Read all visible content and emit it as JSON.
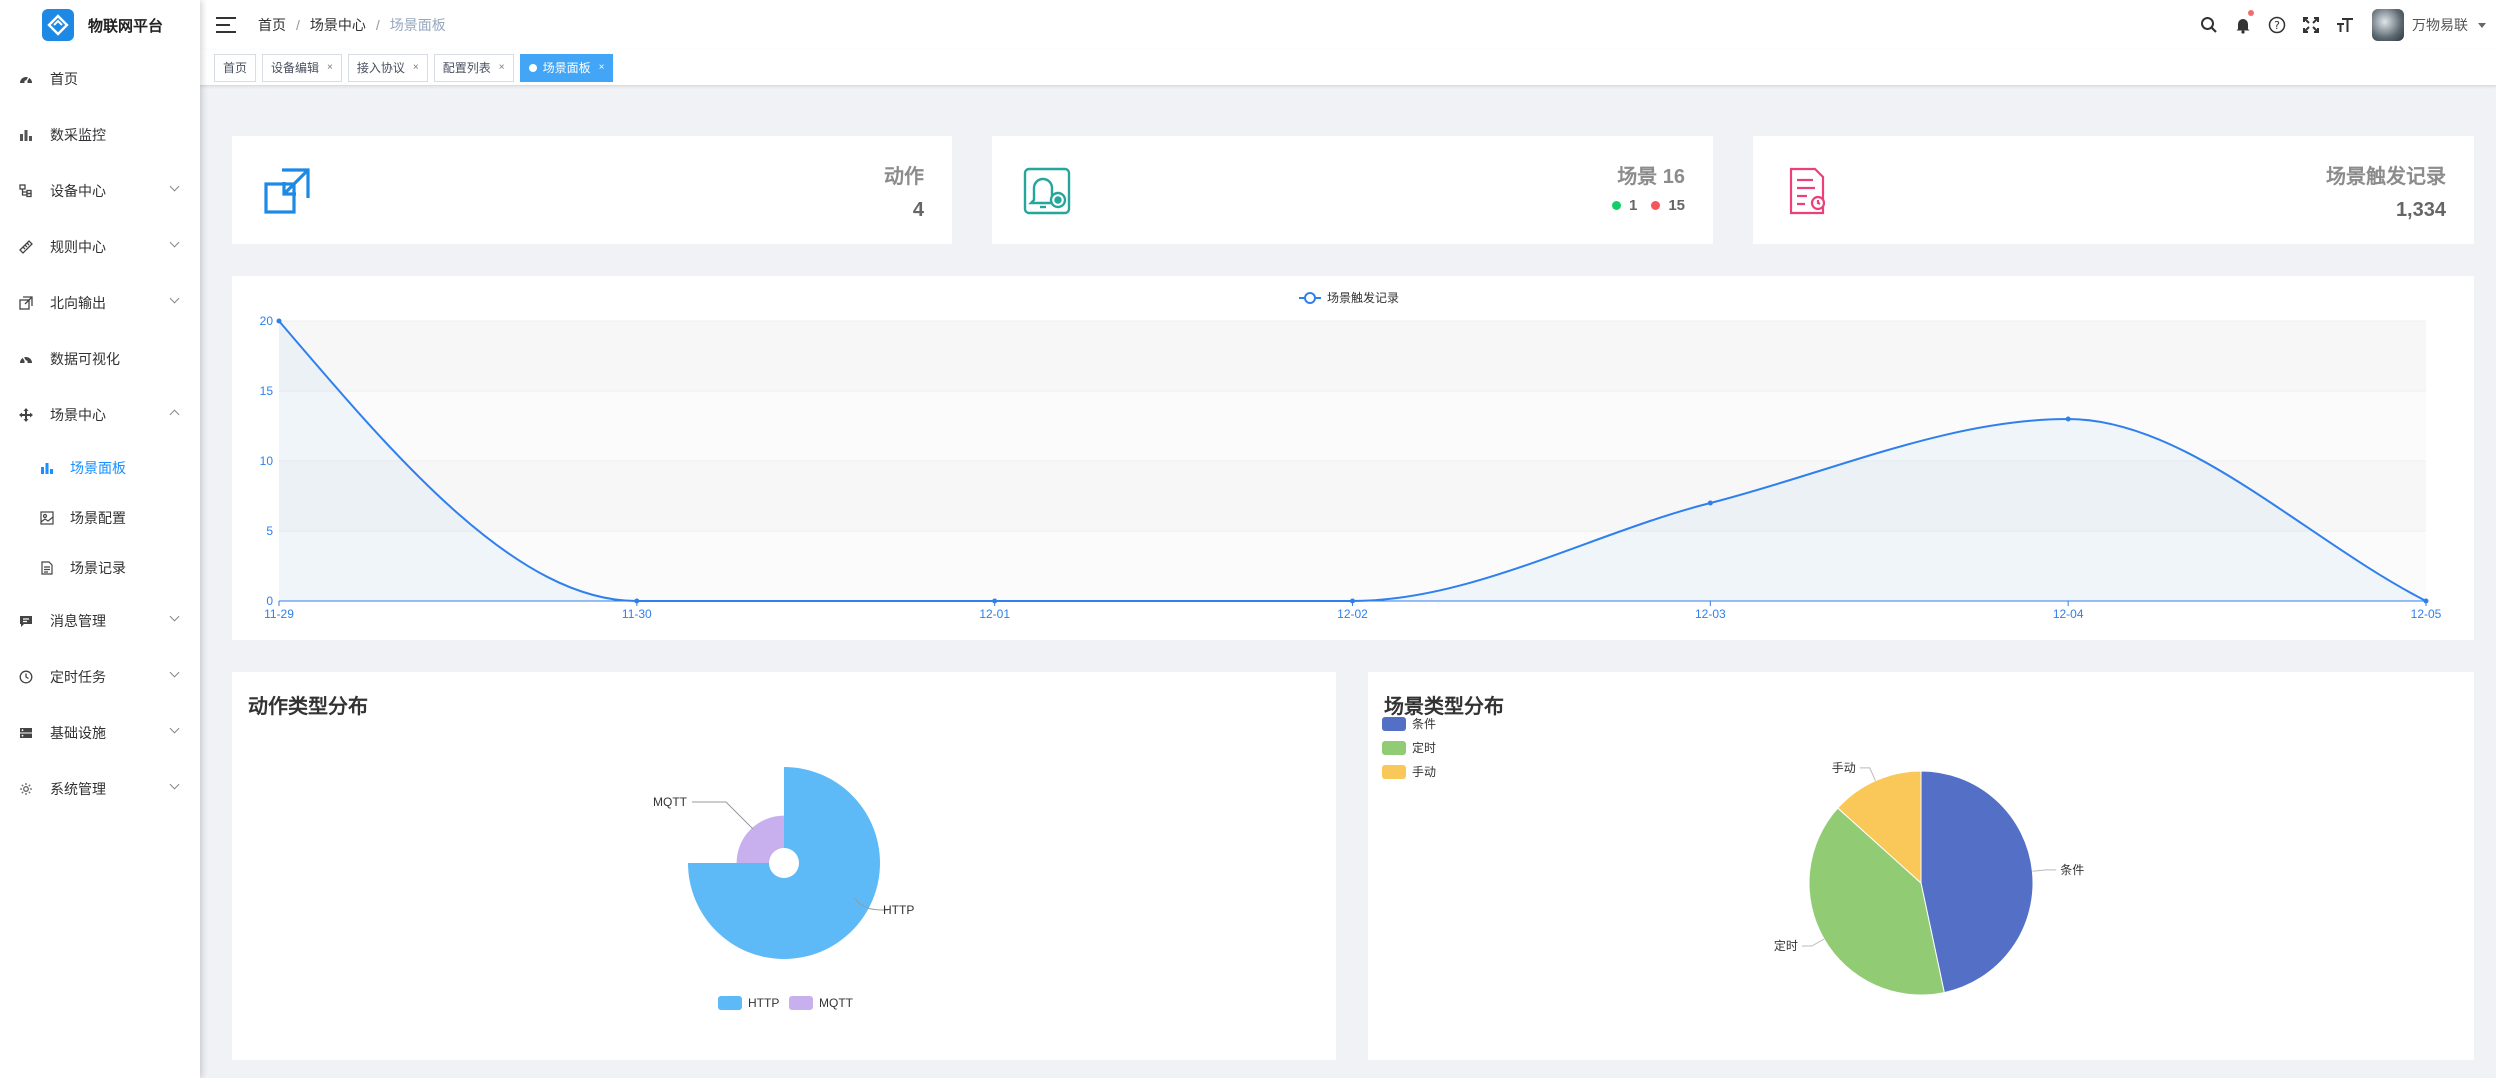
{
  "app": {
    "title": "物联网平台"
  },
  "sidebar": {
    "items": [
      {
        "label": "首页",
        "icon": "dashboard-icon"
      },
      {
        "label": "数采监控",
        "icon": "bar-chart-icon"
      },
      {
        "label": "设备中心",
        "icon": "device-tree-icon"
      },
      {
        "label": "规则中心",
        "icon": "ruler-icon"
      },
      {
        "label": "北向输出",
        "icon": "export-icon"
      },
      {
        "label": "数据可视化",
        "icon": "visual-dashboard-icon"
      },
      {
        "label": "场景中心",
        "icon": "move-icon"
      }
    ],
    "sub_items": [
      {
        "label": "场景面板",
        "icon": "bar-chart-icon"
      },
      {
        "label": "场景配置",
        "icon": "image-config-icon"
      },
      {
        "label": "场景记录",
        "icon": "document-icon"
      }
    ],
    "items_after": [
      {
        "label": "消息管理",
        "icon": "message-icon"
      },
      {
        "label": "定时任务",
        "icon": "clock-icon"
      },
      {
        "label": "基础设施",
        "icon": "server-icon"
      },
      {
        "label": "系统管理",
        "icon": "gear-icon"
      }
    ]
  },
  "header": {
    "breadcrumb": [
      "首页",
      "场景中心",
      "场景面板"
    ],
    "breadcrumb_sep": "/",
    "username": "万物易联"
  },
  "tags": {
    "items": [
      {
        "label": "首页",
        "closable": false
      },
      {
        "label": "设备编辑",
        "closable": true
      },
      {
        "label": "接入协议",
        "closable": true
      },
      {
        "label": "配置列表",
        "closable": true
      },
      {
        "label": "场景面板",
        "closable": true,
        "active": true
      }
    ],
    "close_glyph": "×"
  },
  "stats": {
    "actions": {
      "title": "动作",
      "value": "4",
      "color": "#1e88e5"
    },
    "scenes": {
      "title": "场景 16",
      "enabled": "1",
      "disabled": "15",
      "enabled_color": "#13ce66",
      "disabled_color": "#f5555b",
      "color": "#26a69a"
    },
    "records": {
      "title": "场景触发记录",
      "value": "1,334",
      "color": "#ec407a"
    }
  },
  "line_chart": {
    "legend": "场景触发记录",
    "color": "#2f80ed"
  },
  "action_pie": {
    "title": "动作类型分布"
  },
  "scene_pie": {
    "title": "场景类型分布"
  },
  "chart_data": [
    {
      "type": "line",
      "series": [
        {
          "name": "场景触发记录",
          "values": [
            20,
            0,
            0,
            0,
            7,
            13,
            0
          ]
        }
      ],
      "categories": [
        "11-29",
        "11-30",
        "12-01",
        "12-02",
        "12-03",
        "12-04",
        "12-05"
      ],
      "yticks": [
        "0",
        "5",
        "10",
        "15",
        "20"
      ],
      "ylim": [
        0,
        20
      ],
      "smooth": true,
      "area": true,
      "legend": "top-center",
      "colors": [
        "#2f80ed"
      ]
    },
    {
      "type": "pie",
      "variant": "nightingale-rose",
      "labels": [
        "HTTP",
        "MQTT"
      ],
      "values": [
        3,
        1
      ],
      "colors": [
        "#5ebaf7",
        "#c7b0ed"
      ],
      "legend": "bottom-center"
    },
    {
      "type": "pie",
      "labels": [
        "条件",
        "定时",
        "手动"
      ],
      "values": [
        7,
        6,
        2
      ],
      "colors": [
        "#5470c6",
        "#91cc75",
        "#fac858"
      ],
      "legend": "top-left"
    }
  ]
}
